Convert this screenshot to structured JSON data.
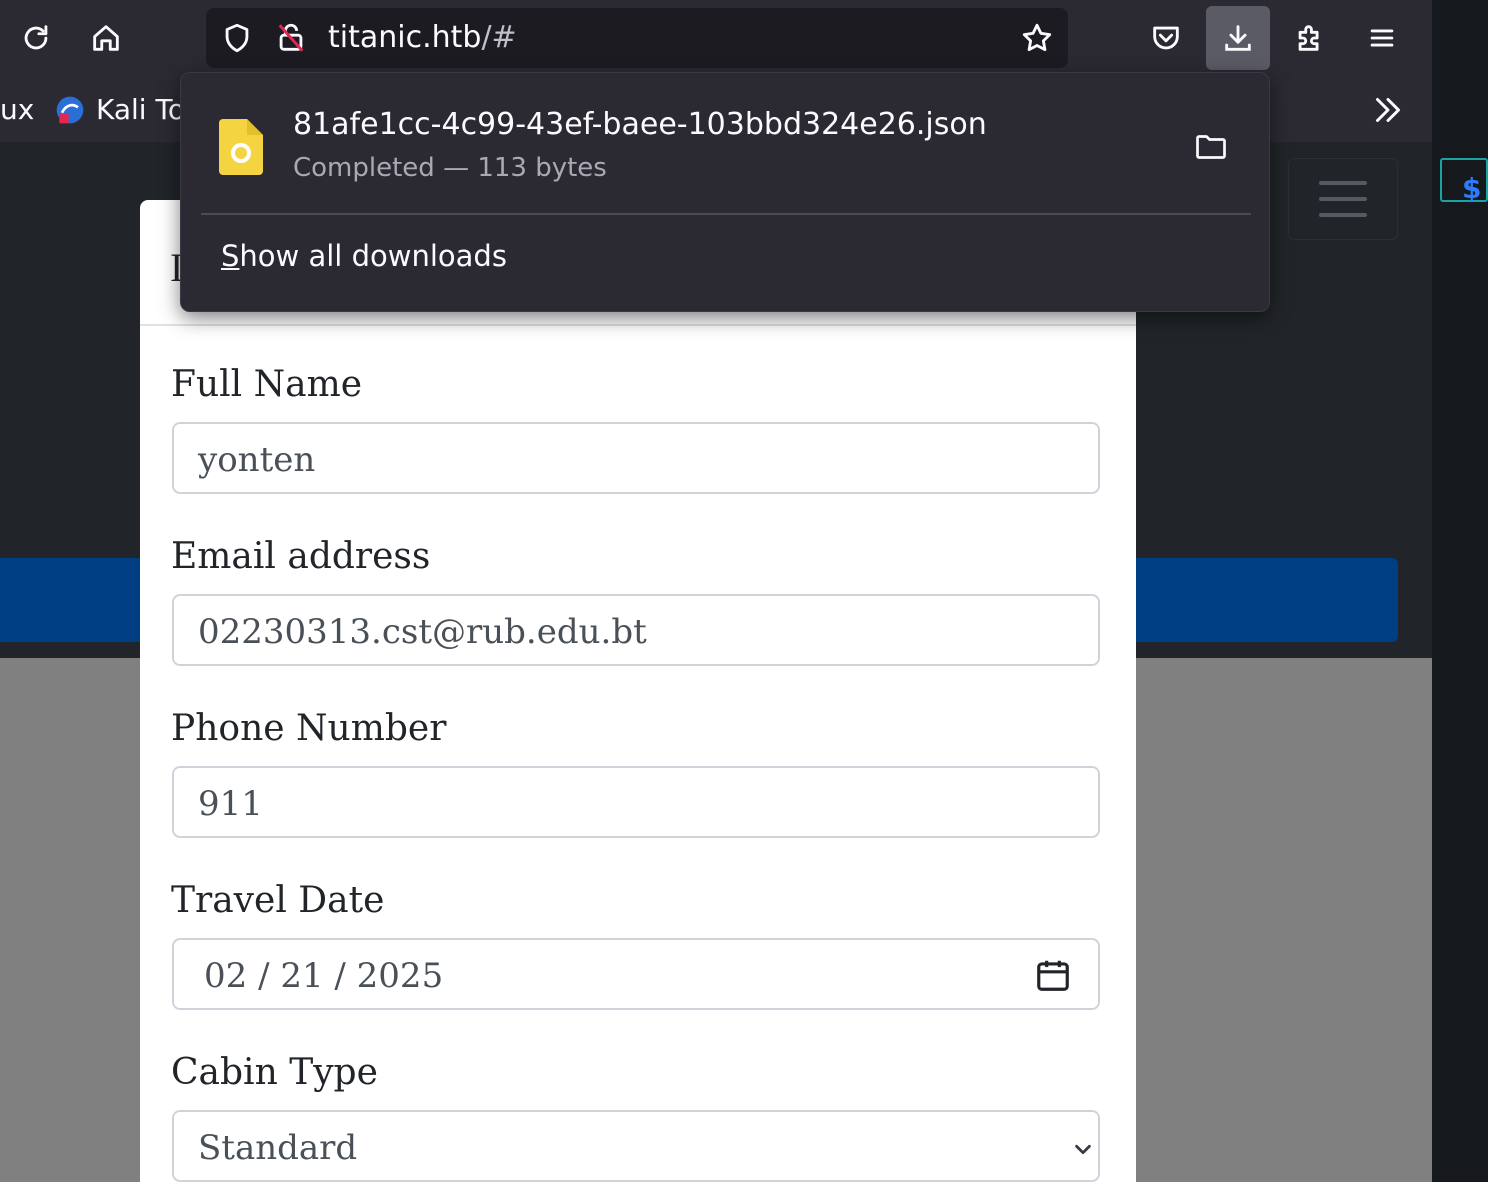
{
  "browser": {
    "url_host": "titanic.htb",
    "url_rest": "/#",
    "bookmarks": [
      {
        "label": "ux"
      },
      {
        "label": "Kali To"
      }
    ]
  },
  "downloads_panel": {
    "filename": "81afe1cc-4c99-43ef-baee-103bbd324e26.json",
    "status": "Completed — 113 bytes",
    "show_all_label": "Show all downloads",
    "show_all_access_key": "S",
    "show_all_rest": "how all downloads"
  },
  "form": {
    "title_fragment": "I",
    "full_name_label": "Full Name",
    "full_name_value": "yonten",
    "email_label": "Email address",
    "email_value": "02230313.cst@rub.edu.bt",
    "phone_label": "Phone Number",
    "phone_value": "911",
    "travel_date_label": "Travel Date",
    "travel_date_value": "02 / 21 / 2025",
    "cabin_type_label": "Cabin Type",
    "cabin_type_value": "Standard"
  },
  "colors": {
    "toolbar": "#2b2a33",
    "page_dark": "#212529",
    "blue_band": "#003e84",
    "overlay_gray": "#808080",
    "file_icon": "#f5d442"
  }
}
